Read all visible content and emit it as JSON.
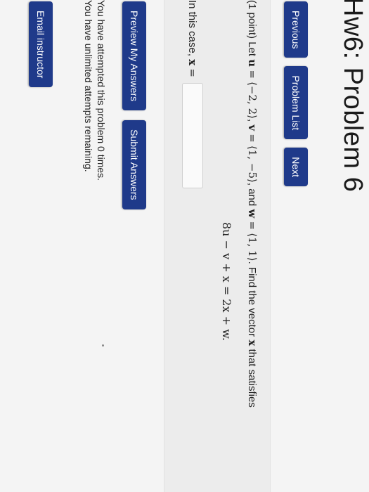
{
  "header": {
    "title": "Hw6: Problem 6"
  },
  "nav": {
    "previous": "Previous",
    "problem_list": "Problem List",
    "next": "Next"
  },
  "problem": {
    "points": "(1 point)",
    "let_text": "Let",
    "u_name": "u",
    "u_value": "⟨−2, 2⟩",
    "v_name": "v",
    "v_value": "⟨1, −5⟩",
    "and_text": "and",
    "w_name": "w",
    "w_value": "⟨1, 1⟩",
    "ending_text": "Find the vector",
    "x_name": "x",
    "satisfies_text": "that satisfies",
    "equation": "8u − v + x = 2x + w.",
    "answer_prompt": "In this case,",
    "answer_var": "x",
    "answer_value": "",
    "answer_placeholder": ""
  },
  "actions": {
    "preview": "Preview My Answers",
    "submit": "Submit Answers"
  },
  "status": {
    "attempted": "You have attempted this problem 0 times.",
    "remaining": "You have unlimited attempts remaining."
  },
  "footer": {
    "email": "Email instructor"
  },
  "colors": {
    "button": "#1f3a8a",
    "background": "#f4f4f4"
  }
}
